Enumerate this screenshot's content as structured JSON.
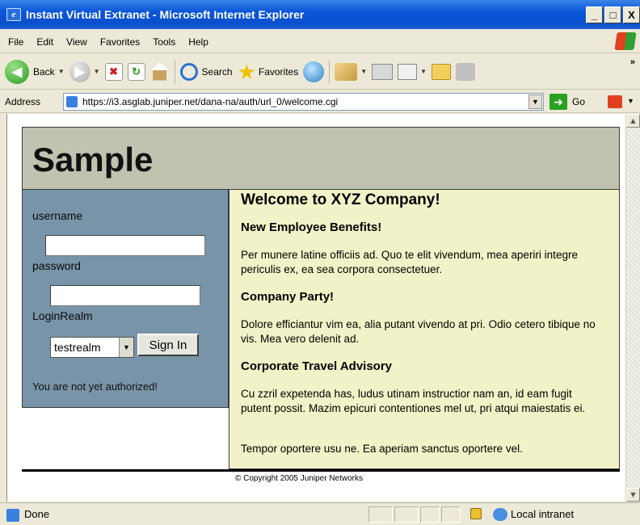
{
  "window": {
    "title": "Instant Virtual Extranet - Microsoft Internet Explorer",
    "controls": [
      "_",
      "□",
      "X"
    ]
  },
  "menu": [
    "File",
    "Edit",
    "View",
    "Favorites",
    "Tools",
    "Help"
  ],
  "toolbar": {
    "back_label": "Back",
    "search_label": "Search",
    "favorites_label": "Favorites",
    "overflow": "»"
  },
  "address": {
    "label": "Address",
    "url": "https://i3.asglab.juniper.net/dana-na/auth/url_0/welcome.cgi",
    "go_label": "Go"
  },
  "page": {
    "header_title": "Sample",
    "login": {
      "username_label": "username",
      "username_value": "",
      "password_label": "password",
      "password_value": "",
      "realm_label": "LoginRealm",
      "realm_value": "testrealm",
      "signin_label": "Sign In",
      "status": "You are not yet authorized!"
    },
    "content": {
      "title": "Welcome to XYZ Company!",
      "sections": [
        {
          "heading": "New Employee Benefits!",
          "text": "Per munere latine officiis ad. Quo te elit vivendum, mea aperiri integre periculis ex, ea sea corpora consectetuer."
        },
        {
          "heading": "Company Party!",
          "text": "Dolore efficiantur vim ea, alia putant vivendo at pri. Odio cetero tibique no vis. Mea vero delenit ad."
        },
        {
          "heading": "Corporate Travel Advisory",
          "text": "Cu zzril expetenda has, ludus utinam instructior nam an, id eam fugit putent possit. Mazim epicuri contentiones mel ut, pri atqui maiestatis ei."
        }
      ],
      "closing": "Tempor oportere usu ne. Ea aperiam sanctus oportere vel."
    },
    "copyright": "© Copyright 2005 Juniper Networks"
  },
  "status": {
    "text": "Done",
    "zone": "Local intranet"
  }
}
